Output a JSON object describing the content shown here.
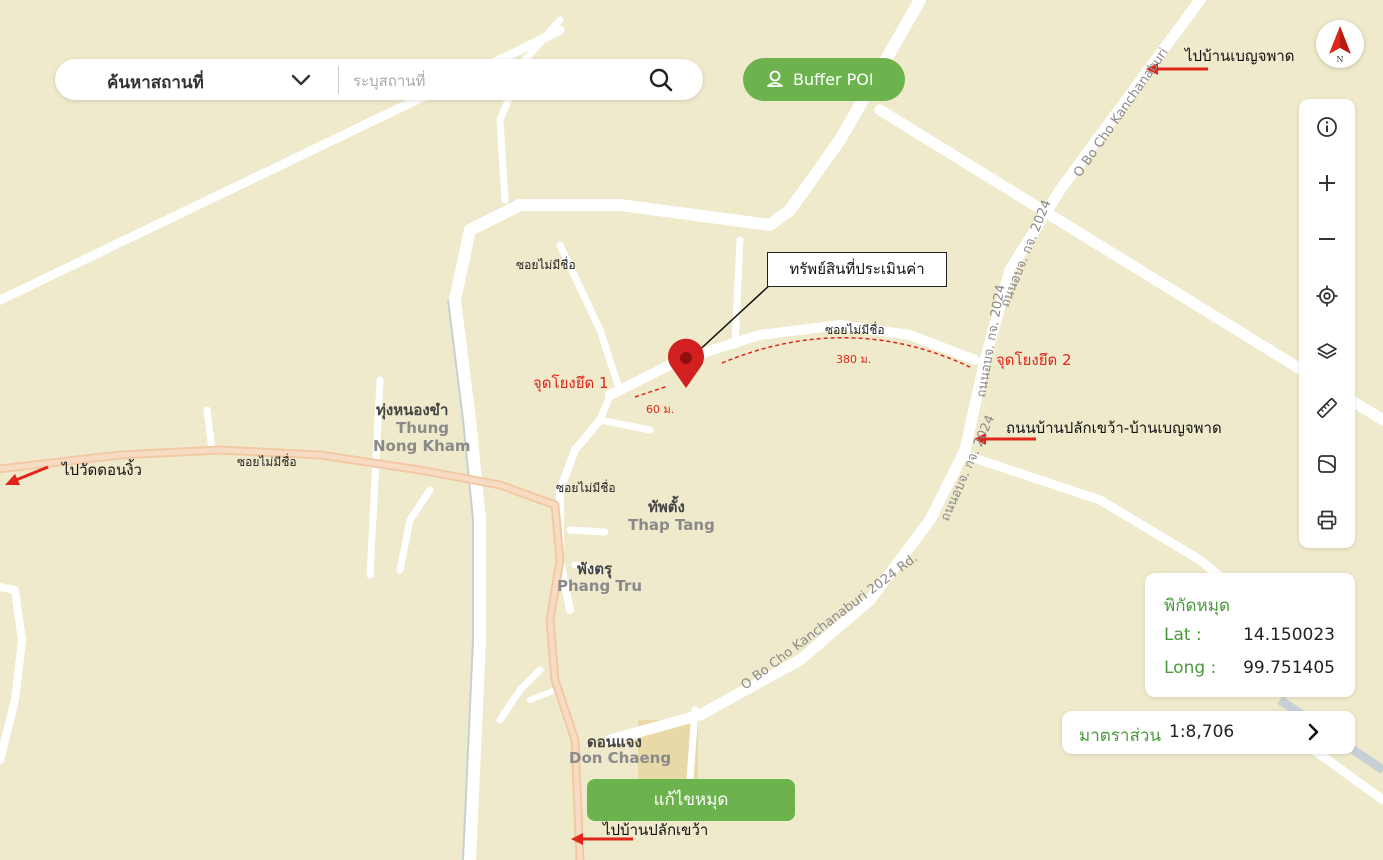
{
  "search": {
    "category_label": "ค้นหาสถานที่",
    "placeholder": "ระบุสถานที่"
  },
  "buffer_button": {
    "label": "Buffer POI"
  },
  "compass": {
    "letter": "N"
  },
  "toolbar": {
    "tools": [
      "info-icon",
      "zoom-in-icon",
      "zoom-out-icon",
      "locate-icon",
      "layers-icon",
      "measure-icon",
      "map-style-icon",
      "print-icon"
    ]
  },
  "coordinates": {
    "title": "พิกัดหมุด",
    "lat_label": "Lat :",
    "lat_value": "14.150023",
    "long_label": "Long :",
    "long_value": "99.751405"
  },
  "scale": {
    "label": "มาตราส่วน",
    "value": "1:8,706"
  },
  "edit_pin_button": {
    "label": "แก้ไขหมุด"
  },
  "map_labels": {
    "places": [
      {
        "th": "ทุ่งหนองขำ",
        "en1": "Thung",
        "en2": "Nong Kham"
      },
      {
        "th": "ทัพตั้ง",
        "en": "Thap Tang"
      },
      {
        "th": "พังตรุ",
        "en": "Phang Tru"
      },
      {
        "th": "ดอนแจง",
        "en": "Don Chaeng"
      }
    ],
    "soi_unnamed": "ซอยไม่มีชื่อ",
    "road_label": "O Bo Cho Kanchanaburi 2024 Rd.",
    "road_label_th": "ถนนอบจ. กจ. 2024",
    "road_label_top": "O Bo Cho Kanchanaburi",
    "road_label_top_th": "ถนนอบจ. กจ. 2024"
  },
  "annotations": {
    "asset": "ทรัพย์สินที่ประเมินค่า",
    "tie_point_1": "จุดโยงยึด 1",
    "tie_point_2": "จุดโยงยึด 2",
    "dist_1": "60 ม.",
    "dist_2": "380 ม.",
    "road_name": "ถนนบ้านปลักเขว้า-บ้านเบญจพาด",
    "to_benjaphat": "ไปบ้านเบญจพาด",
    "to_wat_don_ngio": "ไปวัดดอนงิ้ว",
    "to_plak_khwao": "ไปบ้านปลักเขว้า"
  },
  "colors": {
    "accent_green": "#6cb34e",
    "text_green": "#4a9a3c",
    "annotation_red": "#e0251b",
    "map_bg": "#efeacb"
  }
}
